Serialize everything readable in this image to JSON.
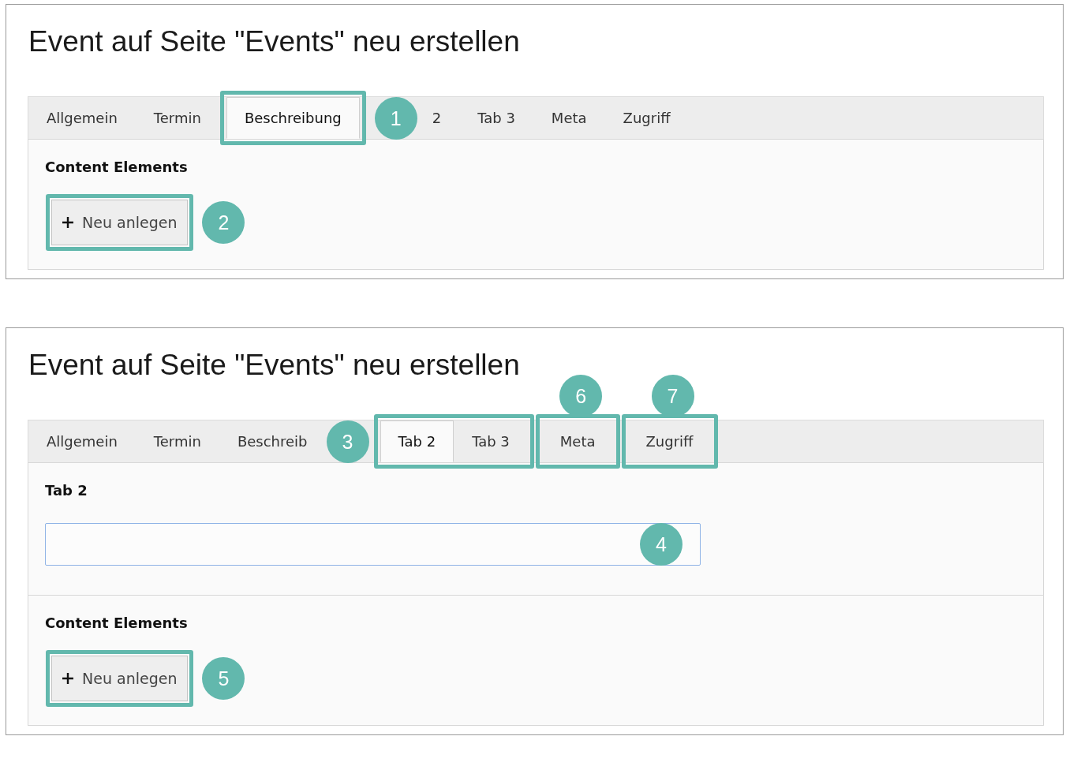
{
  "panels": [
    {
      "title": "Event auf Seite \"Events\" neu erstellen",
      "tabs": [
        {
          "label": "Allgemein",
          "selected": false
        },
        {
          "label": "Termin",
          "selected": false
        },
        {
          "label": "Beschreibung",
          "selected": true,
          "kind": "framed",
          "callout": {
            "number": "1",
            "kind": "right"
          }
        },
        {
          "label": "2",
          "selected": false
        },
        {
          "label": "Tab 3",
          "selected": false
        },
        {
          "label": "Meta",
          "selected": false
        },
        {
          "label": "Zugriff",
          "selected": false
        }
      ],
      "sections": [
        {
          "kind": "elements",
          "heading": "Content Elements",
          "button": {
            "label": "Neu anlegen",
            "framed": true,
            "callout": {
              "number": "2",
              "kind": "right"
            }
          }
        }
      ]
    },
    {
      "title": "Event auf Seite \"Events\" neu erstellen",
      "tabs": [
        {
          "label": "Allgemein",
          "selected": false
        },
        {
          "label": "Termin",
          "selected": false
        },
        {
          "label": "Beschreib",
          "selected": false
        },
        {
          "label": "Tab 2",
          "selected": true,
          "kind": "groupstart",
          "callout": {
            "number": "3",
            "kind": "left"
          }
        },
        {
          "label": "Tab 3",
          "selected": false,
          "kind": "groupend"
        },
        {
          "label": "Meta",
          "selected": false,
          "kind": "framed",
          "callout": {
            "number": "6",
            "kind": "above"
          }
        },
        {
          "label": "Zugriff",
          "selected": false,
          "kind": "framed",
          "callout": {
            "number": "7",
            "kind": "above"
          }
        }
      ],
      "sections": [
        {
          "kind": "field",
          "heading": "Tab 2",
          "callout": {
            "number": "4",
            "kind": "inside"
          }
        },
        {
          "kind": "elements",
          "heading": "Content Elements",
          "button": {
            "label": "Neu anlegen",
            "framed": true,
            "callout": {
              "number": "5",
              "kind": "right"
            }
          }
        }
      ]
    }
  ]
}
